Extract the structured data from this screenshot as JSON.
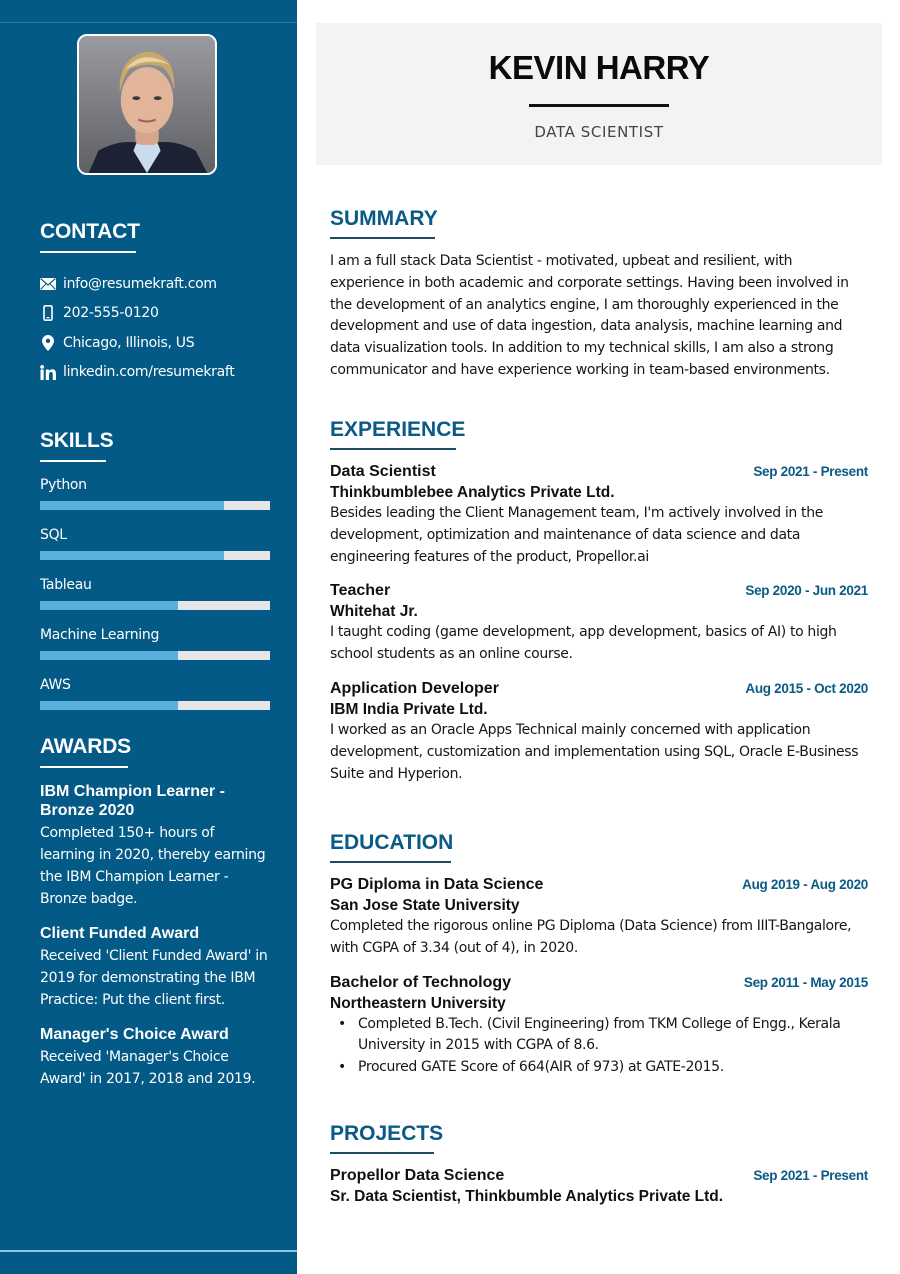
{
  "profile": {
    "name": "KEVIN HARRY",
    "role": "DATA SCIENTIST",
    "photo_alt": "Profile photo of Kevin Harry"
  },
  "colors": {
    "sidebar_bg": "#045a86",
    "accent": "#0a5a85",
    "skill_fill": "#5aafdc",
    "skill_track": "#e6e6e6",
    "header_bg": "#f3f3f3"
  },
  "contact": {
    "heading": "CONTACT",
    "items": [
      {
        "icon": "envelope-icon",
        "text": "info@resumekraft.com"
      },
      {
        "icon": "phone-icon",
        "text": "202-555-0120"
      },
      {
        "icon": "location-pin-icon",
        "text": "Chicago, Illinois, US"
      },
      {
        "icon": "linkedin-icon",
        "text": "linkedin.com/resumekraft"
      }
    ]
  },
  "skills": {
    "heading": "SKILLS",
    "items": [
      {
        "label": "Python",
        "level_percent": 80
      },
      {
        "label": "SQL",
        "level_percent": 80
      },
      {
        "label": "Tableau",
        "level_percent": 60
      },
      {
        "label": "Machine Learning",
        "level_percent": 60
      },
      {
        "label": "AWS",
        "level_percent": 60
      }
    ]
  },
  "awards": {
    "heading": "AWARDS",
    "items": [
      {
        "title": "IBM Champion Learner - Bronze 2020",
        "desc": "Completed 150+ hours of learning in 2020, thereby earning the IBM Champion Learner - Bronze badge."
      },
      {
        "title": "Client Funded Award",
        "desc": "Received 'Client Funded Award' in 2019 for demonstrating the IBM Practice: Put the client first."
      },
      {
        "title": "Manager's Choice Award",
        "desc": "Received 'Manager's Choice Award' in 2017, 2018 and 2019."
      }
    ]
  },
  "summary": {
    "heading": "SUMMARY",
    "text": "I am a full stack Data Scientist - motivated, upbeat and resilient, with experience in both academic and corporate settings. Having been involved in the development of an analytics engine, I am thoroughly experienced in the development and use of data ingestion, data analysis, machine learning and data visualization tools. In addition to my technical skills, I am also a strong communicator and have experience working in team-based environments."
  },
  "experience": {
    "heading": "EXPERIENCE",
    "items": [
      {
        "title": "Data Scientist",
        "date": "Sep 2021 - Present",
        "org": "Thinkbumblebee Analytics Private Ltd.",
        "desc": "Besides leading the Client Management team, I'm actively involved in the development, optimization and maintenance of data science and data engineering features of the product, Propellor.ai"
      },
      {
        "title": "Teacher",
        "date": "Sep 2020 - Jun 2021",
        "org": "Whitehat Jr.",
        "desc": "I taught coding (game development, app development, basics of AI) to high school students as an online course."
      },
      {
        "title": "Application Developer",
        "date": "Aug 2015 - Oct 2020",
        "org": "IBM India Private Ltd.",
        "desc": "I worked as an Oracle Apps Technical mainly concerned with application development, customization and implementation using SQL, Oracle E-Business Suite and Hyperion."
      }
    ]
  },
  "education": {
    "heading": "EDUCATION",
    "items": [
      {
        "title": "PG Diploma in Data Science",
        "date": "Aug 2019 - Aug 2020",
        "org": "San Jose State University",
        "desc": "Completed the rigorous online PG Diploma (Data Science) from IIIT-Bangalore, with CGPA of 3.34 (out of 4), in 2020."
      },
      {
        "title": "Bachelor of Technology",
        "date": "Sep 2011 - May 2015",
        "org": "Northeastern University",
        "bullets": [
          "Completed B.Tech. (Civil Engineering) from TKM College of Engg., Kerala University in 2015 with CGPA of 8.6.",
          "Procured GATE Score of 664(AIR of 973) at GATE-2015."
        ]
      }
    ]
  },
  "projects": {
    "heading": "PROJECTS",
    "items": [
      {
        "title": "Propellor Data Science",
        "date": "Sep 2021 - Present",
        "org": "Sr. Data Scientist, Thinkbumble Analytics Private Ltd."
      }
    ]
  }
}
